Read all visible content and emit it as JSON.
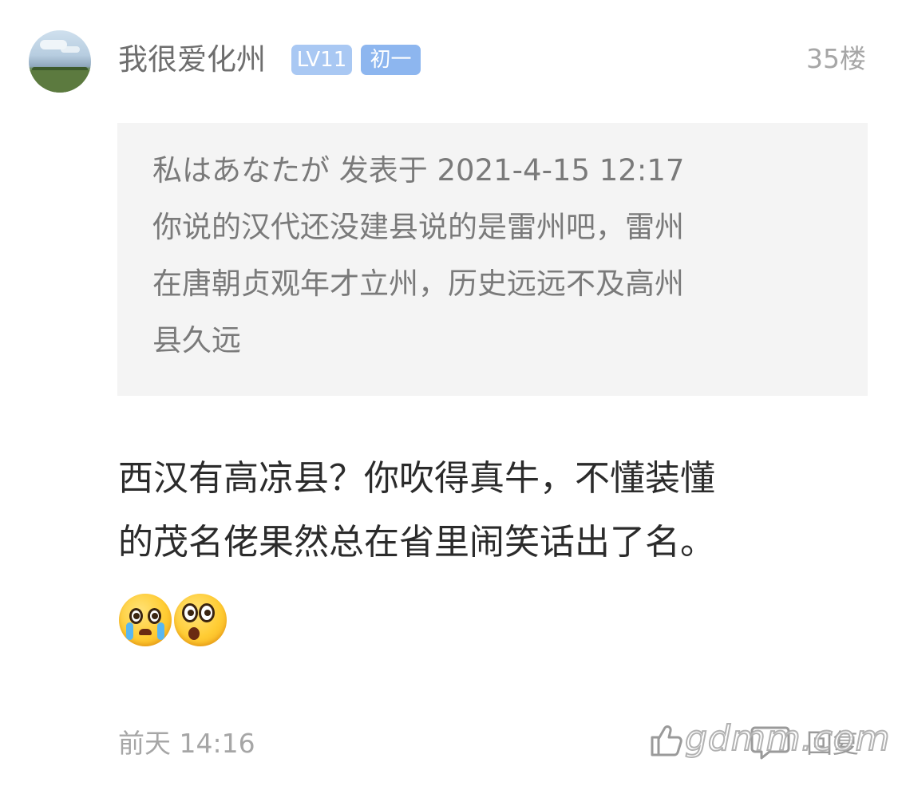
{
  "post": {
    "username": "我很爱化州",
    "level_badge": "LV11",
    "grade_badge": "初一",
    "floor": "35楼",
    "quote": {
      "lines": [
        "私はあなたが 发表于 2021-4-15 12:17",
        "你说的汉代还没建县说的是雷州吧，雷州",
        "在唐朝贞观年才立州，历史远远不及高州",
        "县久远"
      ]
    },
    "content_lines": [
      "西汉有高凉县？你吹得真牛，不懂装懂",
      "的茂名佬果然总在省里闹笑话出了名。"
    ],
    "emojis": [
      "crying-face-emoji",
      "shocked-face-emoji"
    ],
    "timestamp": "前天 14:16",
    "reply_label": "回复",
    "icons": {
      "like": "thumbs-up-icon",
      "reply": "comment-bubble-icon"
    }
  },
  "watermark": "gdmm.com",
  "colors": {
    "background": "#ffffff",
    "quote_background": "#f4f4f4",
    "badge_level": "#a9c8f3",
    "badge_grade": "#8db6ef",
    "muted_text": "#a6a6a6",
    "main_text": "#2b2b2b"
  }
}
